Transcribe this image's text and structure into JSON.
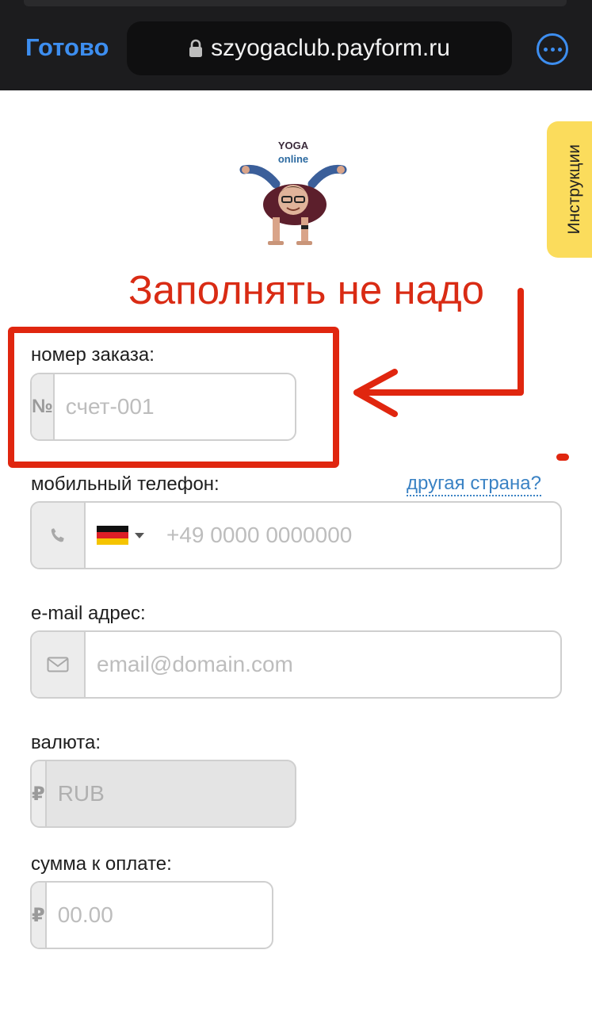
{
  "browser": {
    "done_label": "Готово",
    "url": "szyogaclub.payform.ru"
  },
  "instructions_tab": {
    "label": "Инструкции"
  },
  "logo": {
    "line1": "YOGA",
    "line2": "online"
  },
  "annotation": {
    "text": "Заполнять не надо"
  },
  "form": {
    "order": {
      "label": "номер заказа:",
      "addon": "№",
      "placeholder": "счет-001"
    },
    "phone": {
      "label": "мобильный телефон:",
      "other_country": "другая страна?",
      "placeholder": "+49 0000 0000000",
      "country_flag": "Germany"
    },
    "email": {
      "label": "e-mail адрес:",
      "placeholder": "email@domain.com"
    },
    "currency": {
      "label": "валюта:",
      "addon": "₽",
      "value": "RUB"
    },
    "amount": {
      "label": "сумма к оплате:",
      "addon": "₽",
      "placeholder": "00.00"
    }
  },
  "colors": {
    "accent": "#3d8ef0",
    "annotation_red": "#e0260f",
    "instructions_tab": "#fbdc5c"
  }
}
